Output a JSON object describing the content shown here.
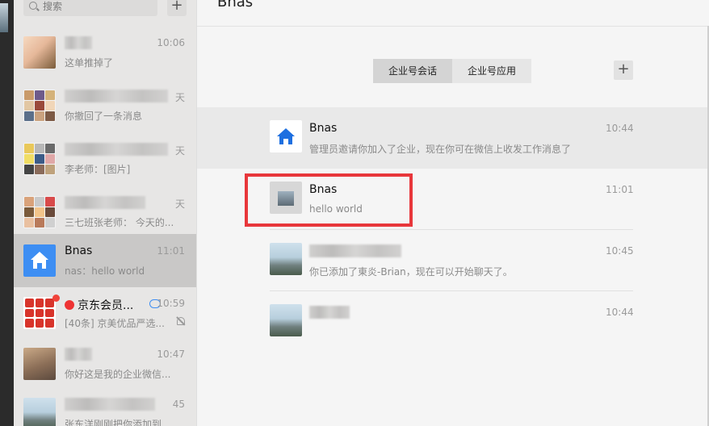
{
  "search": {
    "placeholder": "搜索",
    "add_label": "+"
  },
  "chat_list": [
    {
      "name": "",
      "time": "10:06",
      "preview": "这单推掉了",
      "avatar": "kid-photo"
    },
    {
      "name": "",
      "time": "天",
      "preview": "你撤回了一条消息",
      "avatar": "group-grid"
    },
    {
      "name": "",
      "time": "天",
      "preview": "李老师：[图片]",
      "avatar": "group-grid"
    },
    {
      "name": "",
      "time": "天",
      "preview": "三七班张老师： 今天的...",
      "avatar": "group-grid"
    },
    {
      "name": "Bnas",
      "time": "11:01",
      "preview": "nas：hello world",
      "avatar": "home-icon",
      "active": true
    },
    {
      "name": "京东会员...",
      "time": "10:59",
      "preview": "[40条] 京美优品严选...",
      "avatar": "jd-grid"
    },
    {
      "name": "",
      "time": "10:47",
      "preview": "你好这是我的企业微信...",
      "avatar": "cat-photo"
    },
    {
      "name": "",
      "time": "45",
      "preview": "张东洋刚刚把你添加到...",
      "avatar": "city-photo"
    }
  ],
  "main": {
    "title": "Bnas",
    "tabs": [
      {
        "label": "企业号会话",
        "selected": true
      },
      {
        "label": "企业号应用",
        "selected": false
      }
    ],
    "add_label": "+",
    "sessions": [
      {
        "name": "Bnas",
        "message": "管理员邀请你加入了企业，现在你可在微信上收发工作消息了",
        "time": "10:44",
        "avatar": "home-icon"
      },
      {
        "name": "Bnas",
        "message": "hello world",
        "time": "11:01",
        "avatar": "gray-city"
      },
      {
        "name": "",
        "message": "你已添加了東炎-Brian，现在可以开始聊天了。",
        "time": "10:45",
        "avatar": "city-photo"
      },
      {
        "name": "",
        "message": "",
        "time": "10:44",
        "avatar": "city-photo"
      }
    ]
  },
  "colors": {
    "accent_blue": "#3d8ef3",
    "highlight_red": "#e8373b",
    "list_bg": "#e7e6e5",
    "main_bg": "#f5f5f5"
  }
}
